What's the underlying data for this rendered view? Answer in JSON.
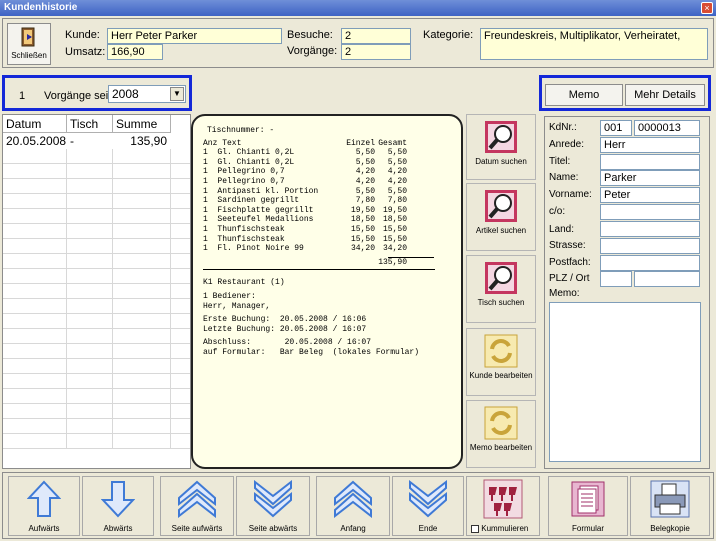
{
  "window": {
    "title": "Kundenhistorie",
    "close": "×"
  },
  "header": {
    "close_label": "Schließen",
    "kunde_label": "Kunde:",
    "kunde_value": "Herr Peter Parker",
    "umsatz_label": "Umsatz:",
    "umsatz_value": "166,90",
    "besuche_label": "Besuche:",
    "besuche_value": "2",
    "vorgaenge_label": "Vorgänge:",
    "vorgaenge_value": "2",
    "kategorie_label": "Kategorie:",
    "kategorie_value": "Freundeskreis, Multiplikator, Verheiratet,"
  },
  "filter": {
    "count": "1",
    "label": "Vorgänge seit",
    "year": "2008"
  },
  "table": {
    "headers": [
      "Datum",
      "Tisch",
      "Summe"
    ],
    "rows": [
      {
        "datum": "20.05.2008",
        "tisch": "-",
        "summe": "135,90"
      }
    ]
  },
  "receipt": {
    "tischnummer": "Tischnummer: -",
    "col_head": [
      "Anz Text",
      "Einzel",
      "Gesamt"
    ],
    "items": [
      [
        "1  Gl. Chianti 0,2L",
        "5,50",
        "5,50"
      ],
      [
        "1  Gl. Chianti 0,2L",
        "5,50",
        "5,50"
      ],
      [
        "1  Pellegrino 0,7",
        "4,20",
        "4,20"
      ],
      [
        "1  Pellegrino 0,7",
        "4,20",
        "4,20"
      ],
      [
        "1  Antipasti kl. Portion",
        "5,50",
        "5,50"
      ],
      [
        "1  Sardinen gegrillt",
        "7,80",
        "7,80"
      ],
      [
        "1  Fischplatte gegrillt",
        "19,50",
        "19,50"
      ],
      [
        "1  Seeteufel Medallions",
        "18,50",
        "18,50"
      ],
      [
        "1  Thunfischsteak",
        "15,50",
        "15,50"
      ],
      [
        "1  Thunfischsteak",
        "15,50",
        "15,50"
      ],
      [
        "1  Fl. Pinot Noire 99",
        "34,20",
        "34,20"
      ]
    ],
    "total": "135,90",
    "footer": [
      "K1 Restaurant (1)",
      "1 Bediener:",
      "Herr, Manager,",
      "Erste Buchung:  20.05.2008 / 16:06",
      "Letzte Buchung: 20.05.2008 / 16:07",
      "Abschluss:       20.05.2008 / 16:07",
      "auf Formular:   Bar Beleg  (lokales Formular)"
    ]
  },
  "side_buttons": [
    "Datum suchen",
    "Artikel suchen",
    "Tisch suchen",
    "Kunde bearbeiten",
    "Memo bearbeiten"
  ],
  "tabs": {
    "memo": "Memo",
    "details": "Mehr Details"
  },
  "details": {
    "kdnr_label": "KdNr.:",
    "kdnr_1": "001",
    "kdnr_2": "0000013",
    "anrede_label": "Anrede:",
    "anrede": "Herr",
    "titel_label": "Titel:",
    "titel": "",
    "name_label": "Name:",
    "name": "Parker",
    "vorname_label": "Vorname:",
    "vorname": "Peter",
    "co_label": "c/o:",
    "co": "",
    "land_label": "Land:",
    "land": "",
    "strasse_label": "Strasse:",
    "strasse": "",
    "postfach_label": "Postfach:",
    "postfach": "",
    "plz_label": "PLZ / Ort",
    "plz": "",
    "ort": "",
    "memo_label": "Memo:",
    "memo": ""
  },
  "nav": {
    "up": "Aufwärts",
    "down": "Abwärts",
    "page_up": "Seite aufwärts",
    "page_down": "Seite abwärts",
    "start": "Anfang",
    "end": "Ende",
    "accumulate": "Kummulieren",
    "form": "Formular",
    "copy": "Belegkopie"
  },
  "colors": {
    "titlebar": "#3d62c4",
    "field_bg": "#ffffd7",
    "highlight_box": "#1428d8",
    "arrow_blue": "#3f7ad6"
  }
}
